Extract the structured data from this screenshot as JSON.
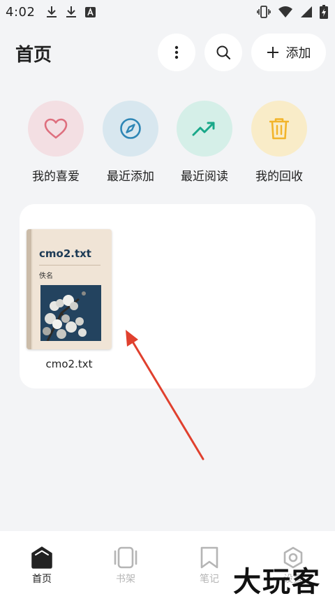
{
  "status_bar": {
    "time": "4:02",
    "left_icons": [
      "download-icon",
      "download-icon",
      "text-a-icon"
    ],
    "right_icons": [
      "vibrate-icon",
      "wifi-icon",
      "signal-icon",
      "battery-charging-icon"
    ]
  },
  "header": {
    "title": "首页",
    "add_label": "添加"
  },
  "quick_access": [
    {
      "label": "我的喜爱",
      "icon": "heart-icon",
      "bg": "#f3dfe3",
      "color": "#de6f7e"
    },
    {
      "label": "最近添加",
      "icon": "compass-icon",
      "bg": "#d8e7ef",
      "color": "#2e86b5"
    },
    {
      "label": "最近阅读",
      "icon": "trending-up-icon",
      "bg": "#d5efe8",
      "color": "#19a889"
    },
    {
      "label": "我的回收",
      "icon": "trash-icon",
      "bg": "#f9ecc8",
      "color": "#f2b42a"
    }
  ],
  "books": [
    {
      "cover_title": "cmo2.txt",
      "cover_author": "佚名",
      "name": "cmo2.txt"
    }
  ],
  "bottom_nav": [
    {
      "label": "首页",
      "icon": "home-icon",
      "active": true
    },
    {
      "label": "书架",
      "icon": "bookshelf-icon",
      "active": false
    },
    {
      "label": "笔记",
      "icon": "bookmark-icon",
      "active": false
    },
    {
      "label": "设置",
      "icon": "settings-hex-icon",
      "active": false
    }
  ],
  "watermark": "大玩客",
  "colors": {
    "annotation_arrow": "#e0402e",
    "nav_inactive": "#b5b5b5",
    "background": "#f3f4f6"
  }
}
